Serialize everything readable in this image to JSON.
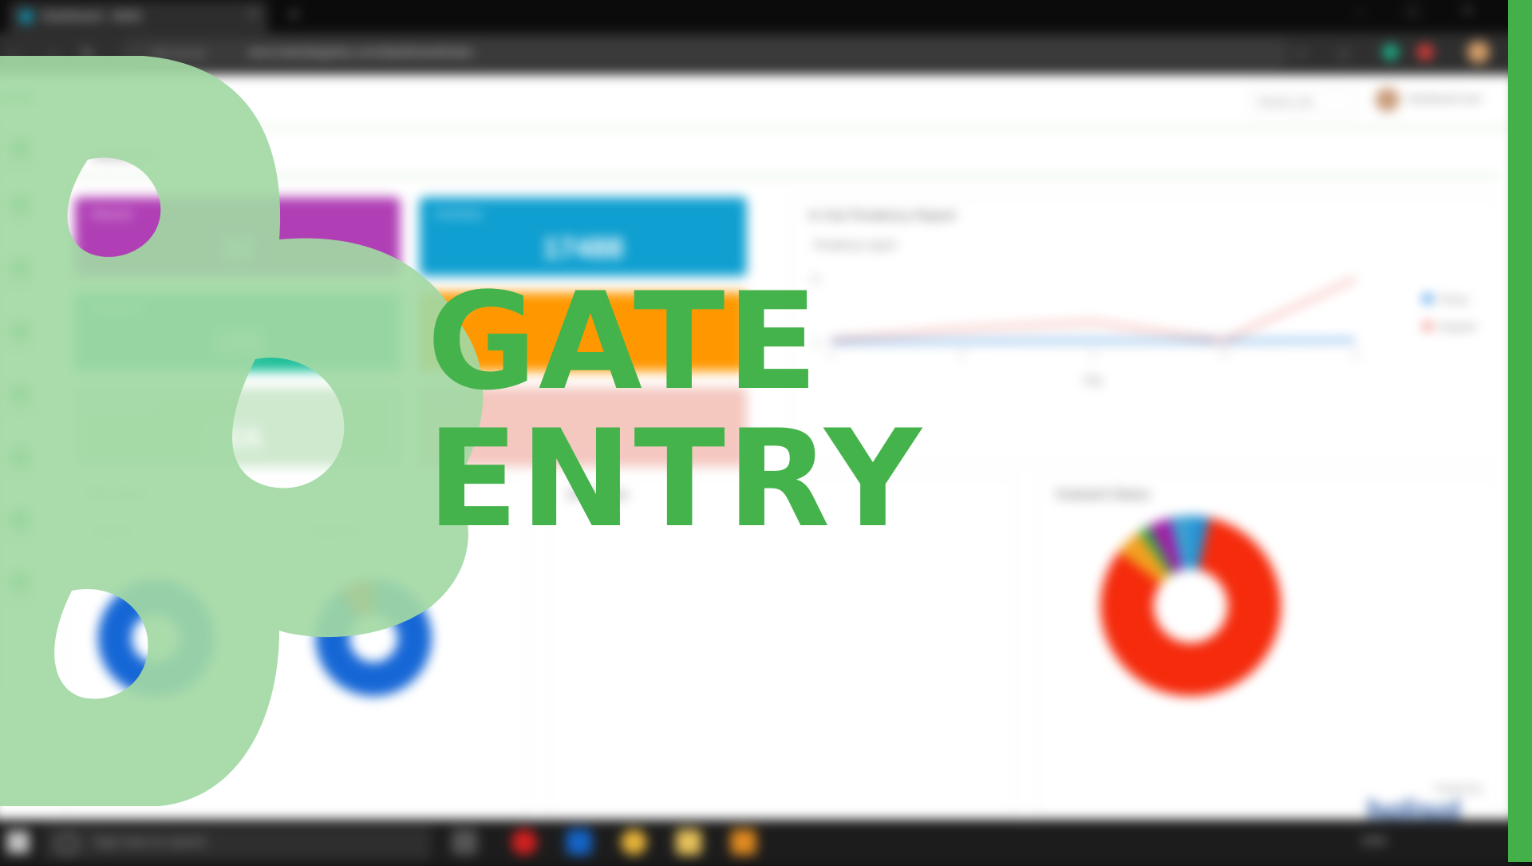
{
  "browser": {
    "tab_title": "Dashboard - WMS",
    "close_glyph": "×",
    "new_tab_glyph": "+",
    "security_label": "Not secure",
    "url": "wms.holisollogistics.com/dashboard/index"
  },
  "app": {
    "brand": "WMS",
    "branch_select": "Branch_Na",
    "user_name": "Dashboard user",
    "breadcrumb": "Dashboard"
  },
  "sidebar": {
    "items": [
      {
        "label": "Dashboard",
        "icon": "dashboard-icon"
      },
      {
        "label": "Inbox",
        "icon": "inbox-icon"
      },
      {
        "label": "Masters",
        "icon": "settings-icon"
      },
      {
        "label": "Inbound",
        "icon": "inbound-icon"
      },
      {
        "label": "Outbound",
        "icon": "outbound-icon"
      },
      {
        "label": "Inventory",
        "icon": "inventory-icon"
      },
      {
        "label": "Reports",
        "icon": "reports-icon"
      },
      {
        "label": "Support",
        "icon": "support-icon"
      }
    ]
  },
  "tiles": [
    {
      "label": "Inbound",
      "value": "32",
      "color": "#b03fb5"
    },
    {
      "label": "Inventory",
      "value": "17488",
      "color": "#0f9fd0"
    },
    {
      "label": "Outbound",
      "value": "185",
      "color": "#20c09a"
    },
    {
      "label": "Orders",
      "value": "",
      "color": "#ff9800"
    },
    {
      "label": "Order Value",
      "value": "N/A",
      "color": "#cfe9cf"
    },
    {
      "label": "Returns",
      "value": "",
      "color": "#f4c7bf"
    }
  ],
  "panels": {
    "pendency": {
      "title": "In Out Pendency Report",
      "subtitle": "Pendency report",
      "xlabel": "Day"
    },
    "tat": {
      "title": "TAT Chart",
      "left_label": "Inbound",
      "right_label": "Outbound"
    },
    "middle": {
      "title": "Inv Status"
    },
    "outward": {
      "title": "Outward Status"
    }
  },
  "chart_data": [
    {
      "type": "line",
      "title": "Pendency report",
      "xlabel": "Day",
      "x": [
        1,
        2,
        3,
        4,
        5
      ],
      "ylim": [
        0,
        10
      ],
      "series": [
        {
          "name": "Pickup",
          "values": [
            0.2,
            0.3,
            0.4,
            0.3,
            0.5
          ],
          "color": "#2b8de8"
        },
        {
          "name": "Dispatch",
          "values": [
            0.5,
            2.2,
            3.2,
            0.4,
            10
          ],
          "color": "#f08a80"
        }
      ],
      "legend": "right"
    },
    {
      "type": "pie",
      "title": "Inbound",
      "slices": [
        {
          "name": "",
          "value": 100,
          "color": "#1667d6"
        }
      ]
    },
    {
      "type": "pie",
      "title": "Outbound",
      "slices": [
        {
          "name": "",
          "value": 90,
          "color": "#1667d6"
        },
        {
          "name": "",
          "value": 7,
          "color": "#e23d1c"
        },
        {
          "name": "",
          "value": 3,
          "color": "#a05a18"
        }
      ]
    },
    {
      "type": "pie",
      "title": "Outward Status",
      "slices": [
        {
          "name": "",
          "value": 3,
          "color": "#1f8ed8"
        },
        {
          "name": "",
          "value": 82,
          "color": "#f52b0c"
        },
        {
          "name": "",
          "value": 5,
          "color": "#f2a020"
        },
        {
          "name": "",
          "value": 2,
          "color": "#29a845"
        },
        {
          "name": "",
          "value": 4,
          "color": "#a11ea7"
        },
        {
          "name": "",
          "value": 4,
          "color": "#3aa0d0"
        }
      ]
    }
  ],
  "overlay": {
    "line1": "GATE",
    "line2": "ENTRY",
    "color": "#45b34b",
    "shape_color": "#a2d8a4"
  },
  "taskbar": {
    "search_placeholder": "Type here to search",
    "language": "ENG"
  },
  "footer": {
    "powered_by": "Powered by",
    "company": "holisol"
  }
}
